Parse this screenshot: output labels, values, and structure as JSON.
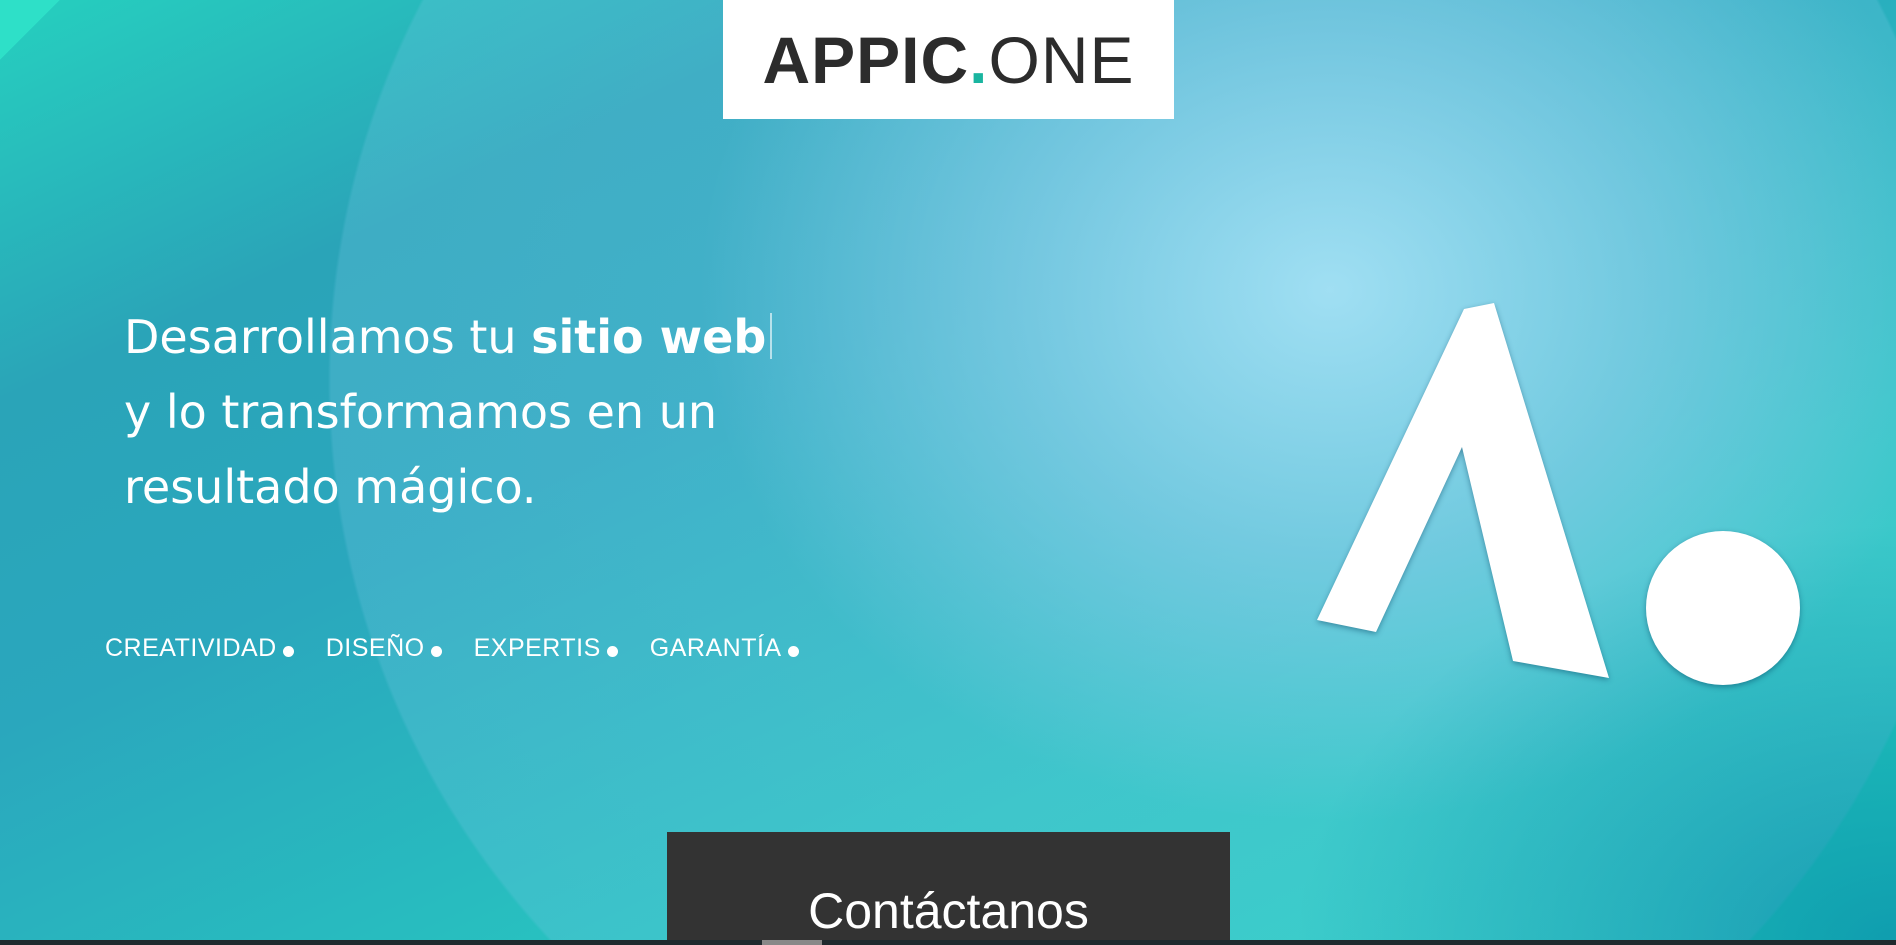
{
  "logo": {
    "part1": "APPIC",
    "dot": ".",
    "part2": "ONE",
    "accent_color": "#1ab5a0"
  },
  "hero": {
    "line1_regular": "Desarrollamos tu ",
    "line1_bold": "sitio web",
    "line2": "y lo transformamos en un",
    "line3": "resultado mágico."
  },
  "tags": [
    {
      "label": "CREATIVIDAD"
    },
    {
      "label": "DISEÑO"
    },
    {
      "label": "EXPERTIS"
    },
    {
      "label": "GARANTÍA"
    }
  ],
  "cta": {
    "label": "Contáctanos"
  },
  "colors": {
    "background_start": "#26d0bf",
    "background_mid": "#2aa4b8",
    "cta_background": "#333333",
    "text": "#ffffff"
  },
  "icons": {
    "brand_mark": "appic-a-dot-logo-icon",
    "tag_bullet": "bullet-dot-icon"
  }
}
